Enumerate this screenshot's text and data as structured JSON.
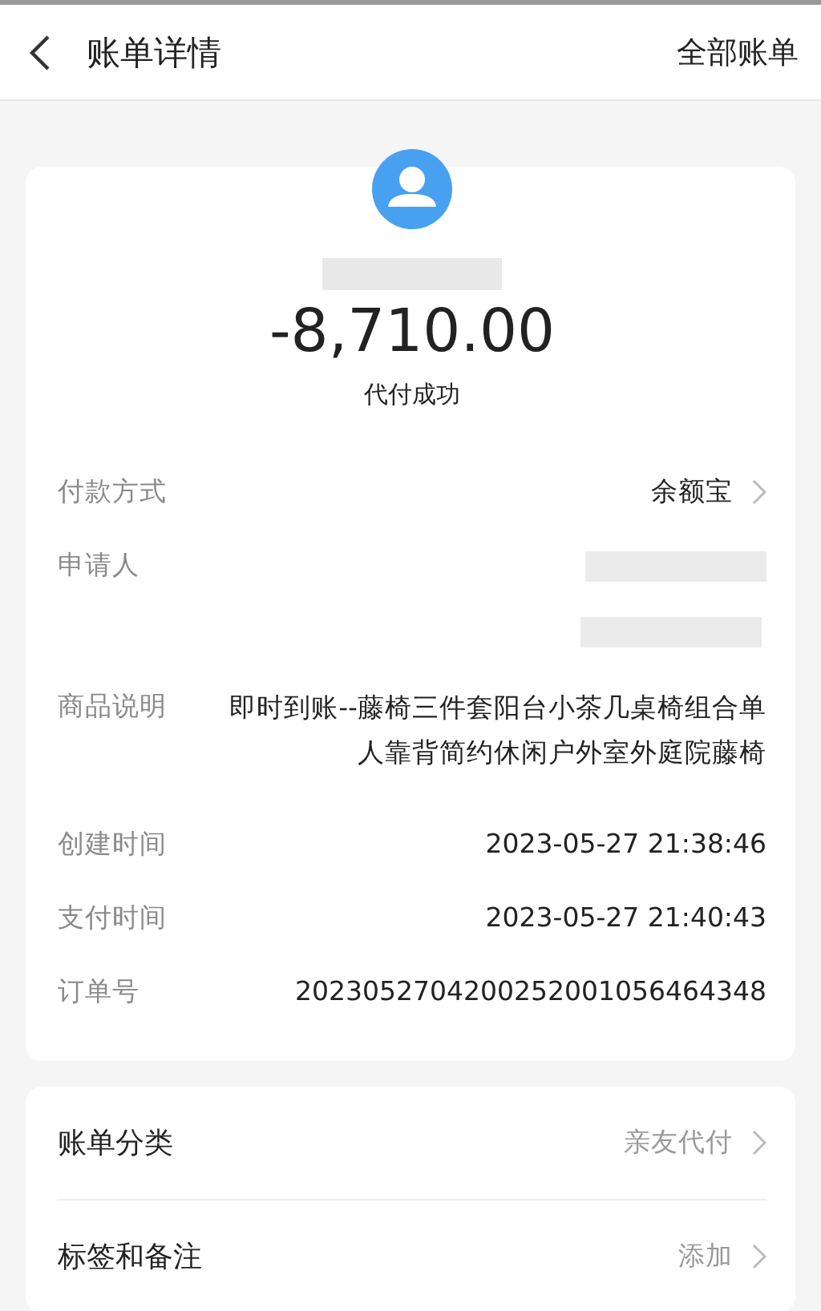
{
  "header": {
    "title": "账单详情",
    "action": "全部账单"
  },
  "summary": {
    "amount": "-8,710.00",
    "status": "代付成功"
  },
  "details": [
    {
      "kind": "link",
      "label": "付款方式",
      "value": "余额宝"
    },
    {
      "kind": "redacted",
      "label": "申请人"
    },
    {
      "kind": "multiline",
      "label": "商品说明",
      "value": "即时到账--藤椅三件套阳台小茶几桌椅组合单人靠背简约休闲户外室外庭院藤椅"
    },
    {
      "kind": "text",
      "label": "创建时间",
      "value": "2023-05-27 21:38:46"
    },
    {
      "kind": "text",
      "label": "支付时间",
      "value": "2023-05-27 21:40:43"
    },
    {
      "kind": "text",
      "label": "订单号",
      "value": "2023052704200252001056464348"
    }
  ],
  "extras": [
    {
      "label": "账单分类",
      "value": "亲友代付"
    },
    {
      "label": "标签和备注",
      "value": "添加"
    }
  ]
}
